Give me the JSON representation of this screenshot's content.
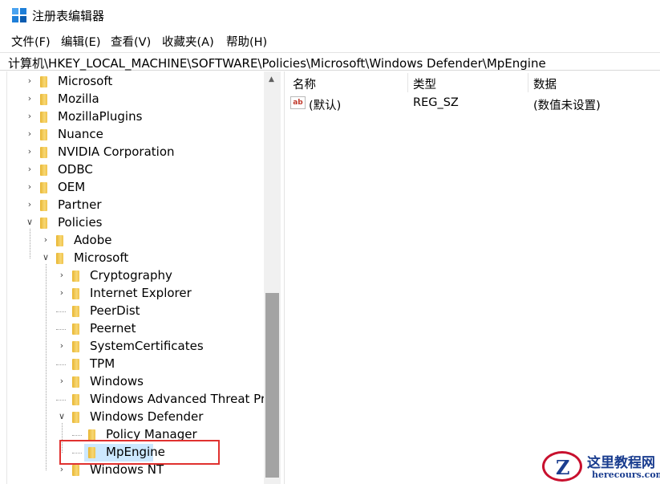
{
  "window": {
    "title": "注册表编辑器",
    "icon": "registry-editor-icon"
  },
  "menu": [
    {
      "label": "文件(F)"
    },
    {
      "label": "编辑(E)"
    },
    {
      "label": "查看(V)"
    },
    {
      "label": "收藏夹(A)"
    },
    {
      "label": "帮助(H)"
    }
  ],
  "address": "计算机\\HKEY_LOCAL_MACHINE\\SOFTWARE\\Policies\\Microsoft\\Windows Defender\\MpEngine",
  "tree": [
    {
      "label": "Microsoft",
      "level": 0,
      "state": "collapsed"
    },
    {
      "label": "Mozilla",
      "level": 0,
      "state": "collapsed"
    },
    {
      "label": "MozillaPlugins",
      "level": 0,
      "state": "collapsed"
    },
    {
      "label": "Nuance",
      "level": 0,
      "state": "collapsed"
    },
    {
      "label": "NVIDIA Corporation",
      "level": 0,
      "state": "collapsed"
    },
    {
      "label": "ODBC",
      "level": 0,
      "state": "collapsed"
    },
    {
      "label": "OEM",
      "level": 0,
      "state": "collapsed"
    },
    {
      "label": "Partner",
      "level": 0,
      "state": "collapsed"
    },
    {
      "label": "Policies",
      "level": 0,
      "state": "expanded"
    },
    {
      "label": "Adobe",
      "level": 1,
      "state": "collapsed"
    },
    {
      "label": "Microsoft",
      "level": 1,
      "state": "expanded"
    },
    {
      "label": "Cryptography",
      "level": 2,
      "state": "collapsed"
    },
    {
      "label": "Internet Explorer",
      "level": 2,
      "state": "collapsed"
    },
    {
      "label": "PeerDist",
      "level": 2,
      "state": "leaf"
    },
    {
      "label": "Peernet",
      "level": 2,
      "state": "leaf"
    },
    {
      "label": "SystemCertificates",
      "level": 2,
      "state": "collapsed"
    },
    {
      "label": "TPM",
      "level": 2,
      "state": "leaf"
    },
    {
      "label": "Windows",
      "level": 2,
      "state": "collapsed"
    },
    {
      "label": "Windows Advanced Threat Pro",
      "level": 2,
      "state": "leaf"
    },
    {
      "label": "Windows Defender",
      "level": 2,
      "state": "expanded"
    },
    {
      "label": "Policy Manager",
      "level": 3,
      "state": "leaf"
    },
    {
      "label": "MpEngine",
      "level": 3,
      "state": "leaf",
      "selected": true
    },
    {
      "label": "Windows NT",
      "level": 2,
      "state": "collapsed"
    }
  ],
  "list": {
    "columns": [
      "名称",
      "类型",
      "数据"
    ],
    "rows": [
      {
        "icon": "ab",
        "name": "(默认)",
        "type": "REG_SZ",
        "data": "(数值未设置)"
      }
    ]
  },
  "colors": {
    "selection": "#cce8ff",
    "highlight_box": "#e0312f",
    "folder": "#f0c24a",
    "scrollbar_thumb": "#a3a3a3"
  },
  "watermark": {
    "title": "这里教程网",
    "url": "herecours.com",
    "logo_letter": "Z"
  }
}
